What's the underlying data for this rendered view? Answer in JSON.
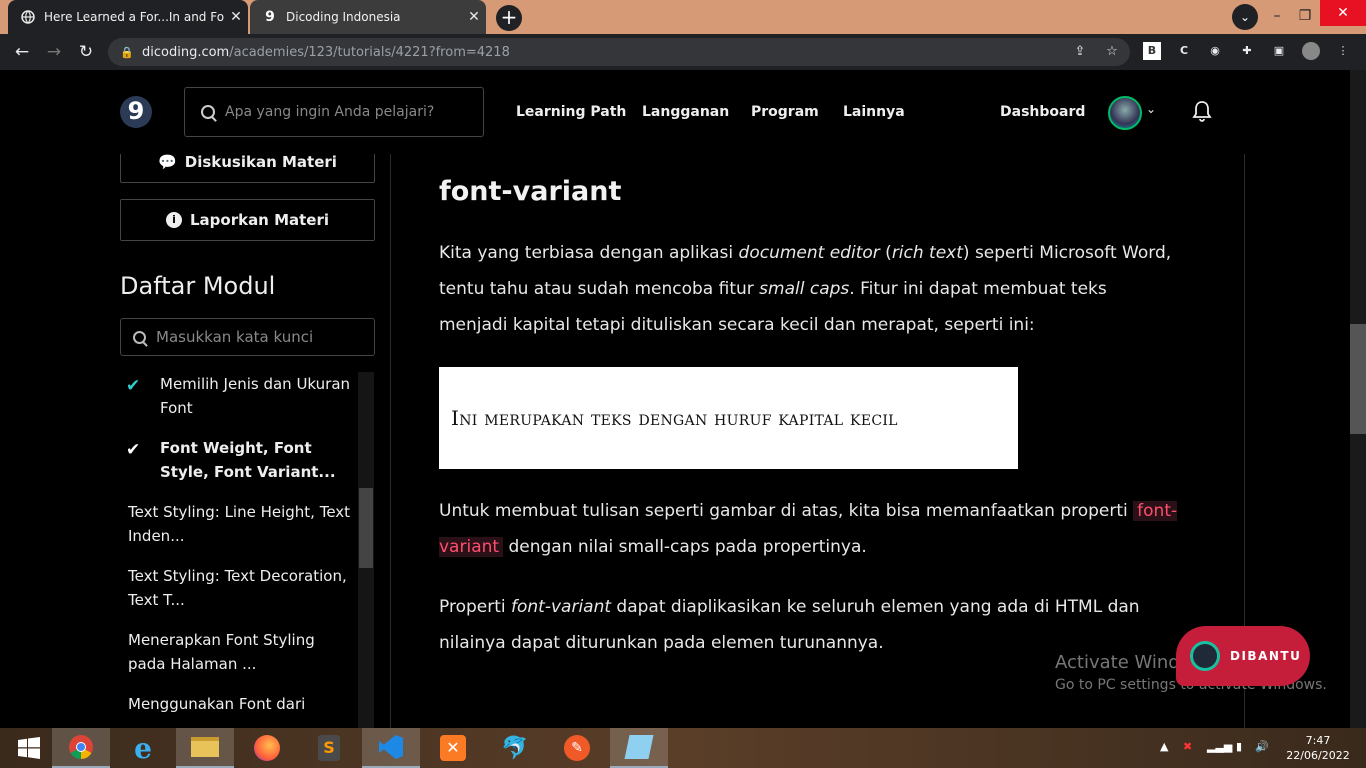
{
  "browser": {
    "tabs": [
      {
        "title": "Here Learned a For...In and For...c",
        "active": true
      },
      {
        "title": "Dicoding Indonesia",
        "active": false
      }
    ],
    "url_host": "dicoding.com",
    "url_path": "/academies/123/tutorials/4221?from=4218"
  },
  "header": {
    "logo": "9",
    "search_placeholder": "Apa yang ingin Anda pelajari?",
    "menu": [
      "Learning Path",
      "Langganan",
      "Program",
      "Lainnya"
    ],
    "dashboard": "Dashboard"
  },
  "sidebar": {
    "discuss_label": "Diskusikan Materi",
    "report_label": "Laporkan Materi",
    "module_heading": "Daftar Modul",
    "search_placeholder": "Masukkan kata kunci",
    "items": [
      {
        "label": "Memilih Jenis dan Ukuran Font",
        "status": "done"
      },
      {
        "label": "Font Weight, Font Style, Font Variant...",
        "status": "current"
      },
      {
        "label": "Text Styling: Line Height, Text Inden...",
        "status": "todo"
      },
      {
        "label": "Text Styling: Text Decoration, Text T...",
        "status": "todo"
      },
      {
        "label": "Menerapkan Font Styling pada Halaman ...",
        "status": "todo"
      },
      {
        "label": "Menggunakan Font dari",
        "status": "todo"
      }
    ]
  },
  "content": {
    "heading": "font-variant",
    "p1": {
      "a": "Kita yang terbiasa dengan aplikasi ",
      "b": "document editor",
      "c": " (",
      "d": "rich text",
      "e": ") seperti Microsoft Word, tentu tahu atau sudah mencoba fitur ",
      "f": "small caps",
      "g": ". Fitur ini dapat membuat teks menjadi kapital tetapi dituliskan secara kecil dan merapat, seperti ini:"
    },
    "demo_text": "Ini merupakan teks dengan huruf kapital kecil",
    "p2": {
      "a": "Untuk membuat tulisan seperti gambar di atas, kita bisa memanfaatkan properti ",
      "code": "font-variant",
      "b": " dengan nilai small-caps pada propertinya."
    },
    "p3": {
      "a": "Properti ",
      "b": "font-variant",
      "c": " dapat diaplikasikan ke seluruh elemen yang ada di HTML dan nilainya dapat diturunkan pada elemen turunannya."
    }
  },
  "overlay": {
    "activate_title": "Activate Windows",
    "activate_sub": "Go to PC settings to activate Windows.",
    "chat_label": "DIBANTU"
  },
  "taskbar": {
    "time": "7:47",
    "date": "22/06/2022"
  },
  "colors": {
    "accent_code": "#ff4d6d",
    "chat": "#c41e3a",
    "check": "#33cccc"
  }
}
